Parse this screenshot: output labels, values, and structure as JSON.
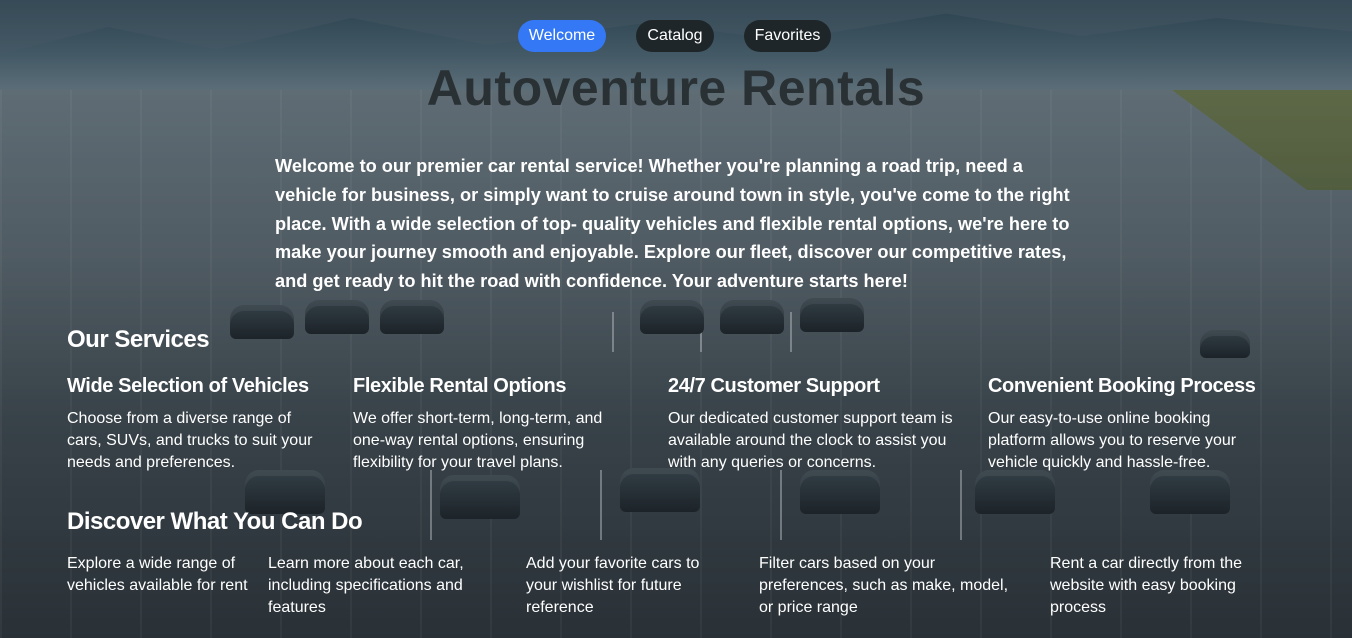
{
  "nav": {
    "items": [
      {
        "label": "Welcome",
        "active": true
      },
      {
        "label": "Catalog",
        "active": false
      },
      {
        "label": "Favorites",
        "active": false
      }
    ],
    "active_color": "#3478f6",
    "inactive_color": "#1f262a"
  },
  "hero": {
    "title": "Autoventure Rentals",
    "intro": "Welcome to our premier car rental service! Whether you're planning a road trip, need a vehicle for business, or simply want to cruise around town in style, you've come to the right place. With a wide selection of top- quality vehicles and flexible rental options, we're here to make your journey smooth and enjoyable. Explore our fleet, discover our competitive rates, and get ready to hit the road with confidence. Your adventure starts here!"
  },
  "services": {
    "heading": "Our Services",
    "items": [
      {
        "title": "Wide Selection of Vehicles",
        "text": "Choose from a diverse range of cars, SUVs, and trucks to suit your needs and preferences."
      },
      {
        "title": "Flexible Rental Options",
        "text": "We offer short-term, long-term, and one-way rental options, ensuring flexibility for your travel plans."
      },
      {
        "title": "24/7 Customer Support",
        "text": "Our dedicated customer support team is available around the clock to assist you with any queries or concerns."
      },
      {
        "title": "Convenient Booking Process",
        "text": "Our easy-to-use online booking platform allows you to reserve your vehicle quickly and hassle-free."
      }
    ]
  },
  "discover": {
    "heading": "Discover What You Can Do",
    "items": [
      "Explore a wide range of vehicles available for rent",
      "Learn more about each car, including specifications and features",
      "Add your favorite cars to your wishlist for future reference",
      "Filter cars based on your preferences, such as make, model, or price range",
      "Rent a car directly from the website with easy booking process"
    ]
  }
}
